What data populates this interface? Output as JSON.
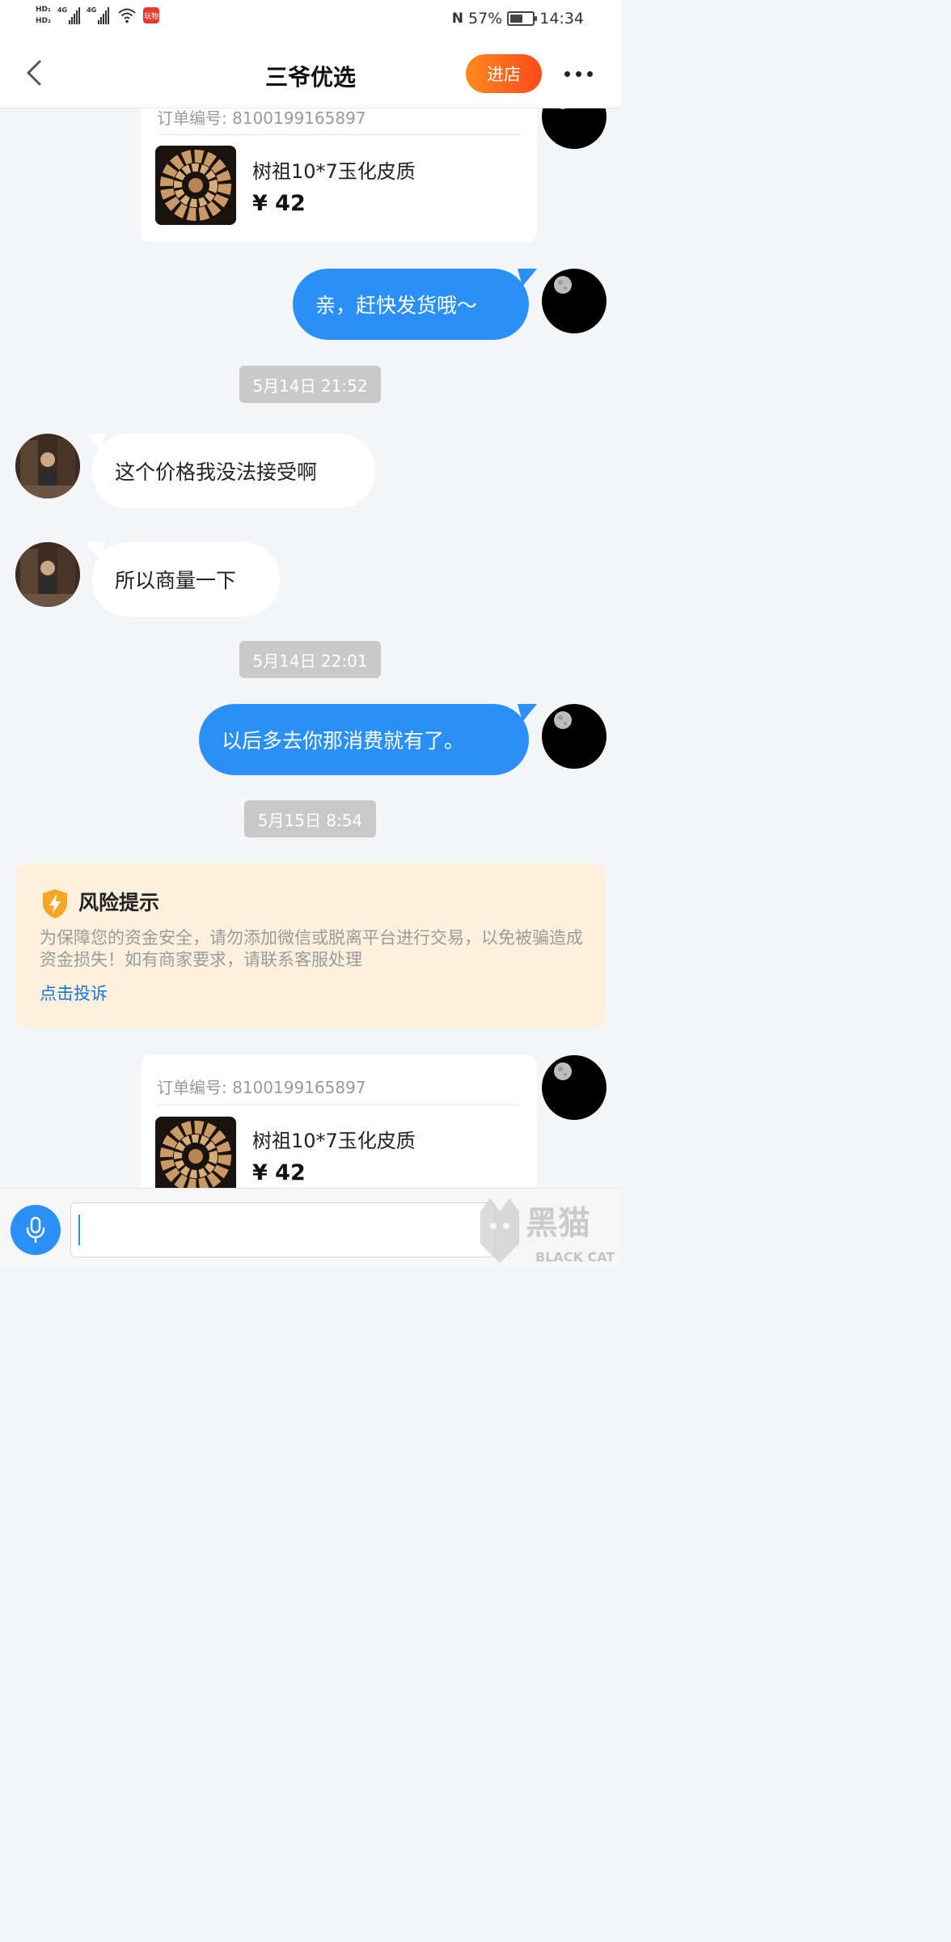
{
  "status_bar": {
    "hd1": "HD₁",
    "hd2": "HD₂",
    "signal1": "4G",
    "signal2": "4G",
    "app_badge": "玩物",
    "nfc": "N",
    "battery": "57%",
    "time": "14:34"
  },
  "header": {
    "title": "三爷优选",
    "enter_store": "进店"
  },
  "messages": {
    "order_card_top": {
      "order_no": "订单编号: 8100199165897",
      "product": "树祖10*7玉化皮质",
      "price": "¥ 42"
    },
    "msg_1": "亲，赶快发货哦～",
    "time_1": "5月14日 21:52",
    "msg_2": "这个价格我没法接受啊",
    "msg_3": "所以商量一下",
    "time_2": "5月14日 22:01",
    "msg_4": "以后多去你那消费就有了。",
    "time_3": "5月15日 8:54",
    "risk": {
      "title": "风险提示",
      "text": "为保障您的资金安全，请勿添加微信或脱离平台进行交易，以免被骗造成资金损失！如有商家要求，请联系客服处理",
      "link": "点击投诉"
    },
    "order_card_bottom": {
      "order_no": "订单编号: 8100199165897",
      "product": "树祖10*7玉化皮质",
      "price": "¥ 42"
    }
  },
  "input_bar": {
    "message_value": "",
    "watermark_cn": "黑猫",
    "watermark_en": "BLACK CAT"
  },
  "colors": {
    "accent_blue": "#2a90f7",
    "enter_store_gradient": [
      "#ff8a1f",
      "#ff4a1c"
    ],
    "risk_background": "#fdf1de",
    "link_blue": "#1a73d9"
  },
  "icons": [
    "back-chevron-icon",
    "more-dots-icon",
    "moon-avatar-icon",
    "shield-lightning-icon",
    "microphone-icon",
    "wifi-icon",
    "battery-icon",
    "signal-icon"
  ]
}
